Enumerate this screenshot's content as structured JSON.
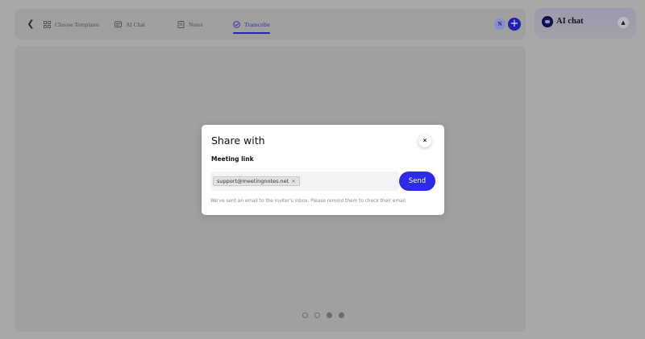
{
  "topbar": {
    "back_icon": "chevron-left-icon",
    "tabs": [
      {
        "label": "Choose Templates",
        "icon": "grid-icon"
      },
      {
        "label": "AI Chat",
        "icon": "message-icon"
      },
      {
        "label": "Notes",
        "icon": "note-icon"
      },
      {
        "label": "Transcribe",
        "icon": "transcribe-icon",
        "active": true
      }
    ],
    "avatar_initial": "N",
    "add_label": "+"
  },
  "ai_chat": {
    "title": "AI chat",
    "toggle_icon": "chevron-up-icon"
  },
  "pagination": {
    "count": 4,
    "filled": [
      2,
      3
    ]
  },
  "modal": {
    "title": "Share with",
    "close_label": "×",
    "section_label": "Meeting link",
    "chip_value": "support@meetingnotes.net",
    "chip_remove": "×",
    "send_label": "Send",
    "note": "We've sent an email to the inviter's inbox. Please remind them to check their email."
  },
  "colors": {
    "accent": "#2b2be8",
    "active_tab": "#2a2aa8",
    "overlay": "#a8a8a8"
  }
}
